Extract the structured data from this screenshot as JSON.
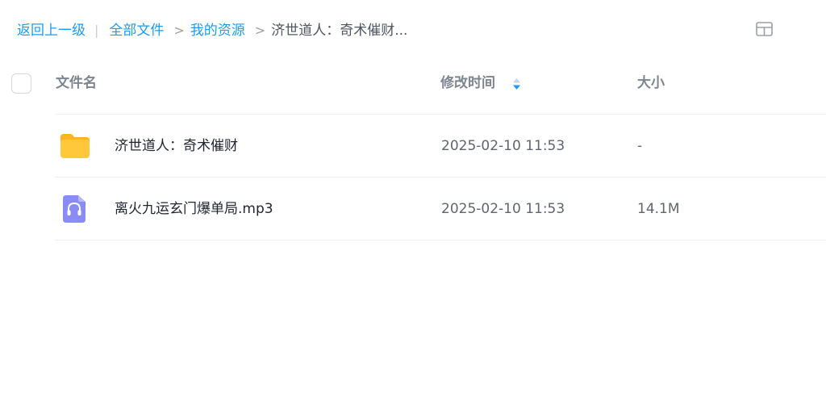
{
  "breadcrumb": {
    "back": "返回上一级",
    "items": [
      {
        "label": "全部文件"
      },
      {
        "label": "我的资源"
      },
      {
        "label": "济世道人：奇术催财..."
      }
    ]
  },
  "table": {
    "headers": {
      "name": "文件名",
      "modified": "修改时间",
      "size": "大小"
    },
    "rows": [
      {
        "type": "folder",
        "icon": "folder-icon",
        "name": "济世道人：奇术催财",
        "modified": "2025-02-10 11:53",
        "size": "-"
      },
      {
        "type": "audio",
        "icon": "audio-file-icon",
        "name": "离火九运玄门爆单局.mp3",
        "modified": "2025-02-10 11:53",
        "size": "14.1M"
      }
    ]
  },
  "colors": {
    "link": "#1e9bf0",
    "sort_active": "#1e9bf0",
    "folder": "#ffc83a",
    "audio_icon": "#8a8cf5"
  }
}
